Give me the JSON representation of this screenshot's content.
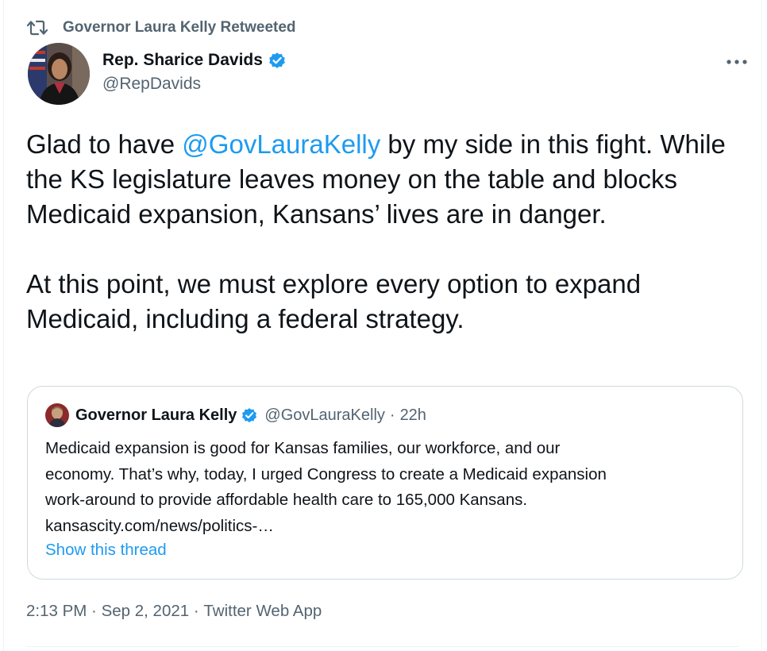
{
  "social_context": {
    "label": "Governor Laura Kelly Retweeted",
    "icon": "retweet-icon"
  },
  "author": {
    "name": "Rep. Sharice Davids",
    "handle": "@RepDavids",
    "verified": true
  },
  "more_icon": "more-icon",
  "tweet": {
    "p1_before": "Glad to have ",
    "p1_mention": "@GovLauraKelly",
    "p1_after": " by my side in this fight. While the KS legislature leaves money on the table and blocks Medicaid expansion, Kansans’ lives are in danger.",
    "p2": "At this point, we must explore every option to expand Medicaid, including a federal strategy."
  },
  "quoted": {
    "name": "Governor Laura Kelly",
    "verified": true,
    "handle": "@GovLauraKelly",
    "separator": "·",
    "time": "22h",
    "lines": [
      "Medicaid expansion is good for Kansas families, our workforce, and our",
      "economy. That’s why, today, I urged Congress to create a Medicaid expansion",
      "work-around to provide affordable health care to 165,000 Kansans.",
      "kansascity.com/news/politics-…"
    ],
    "show_thread": "Show this thread"
  },
  "meta": {
    "time": "2:13 PM",
    "sep": " · ",
    "date": "Sep 2, 2021",
    "source": "Twitter Web App"
  },
  "colors": {
    "accent": "#1d9bf0",
    "secondary_text": "#536471",
    "primary_text": "#0f1419",
    "border": "#cfd9de"
  }
}
